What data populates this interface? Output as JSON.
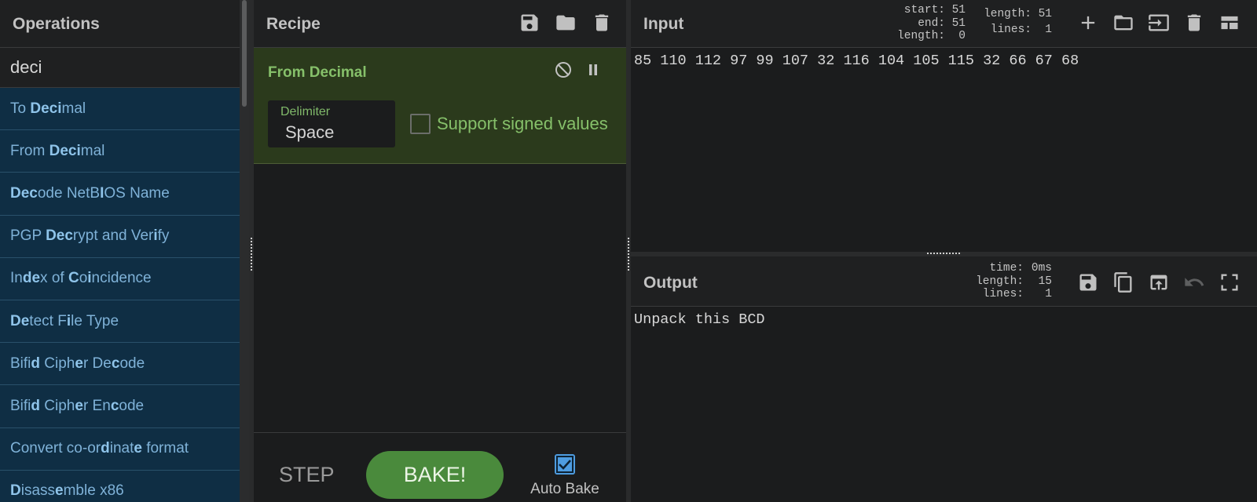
{
  "operations": {
    "title": "Operations",
    "search_value": "deci",
    "items": [
      [
        {
          "t": "To "
        },
        {
          "t": "Deci",
          "b": true
        },
        {
          "t": "mal"
        }
      ],
      [
        {
          "t": "From "
        },
        {
          "t": "Deci",
          "b": true
        },
        {
          "t": "mal"
        }
      ],
      [
        {
          "t": "Dec",
          "b": true
        },
        {
          "t": "ode NetB"
        },
        {
          "t": "I",
          "b": true
        },
        {
          "t": "OS Name"
        }
      ],
      [
        {
          "t": "PGP "
        },
        {
          "t": "Dec",
          "b": true
        },
        {
          "t": "rypt and Ver"
        },
        {
          "t": "i",
          "b": true
        },
        {
          "t": "fy"
        }
      ],
      [
        {
          "t": "In"
        },
        {
          "t": "de",
          "b": true
        },
        {
          "t": "x of "
        },
        {
          "t": "C",
          "b": true
        },
        {
          "t": "o"
        },
        {
          "t": "i",
          "b": true
        },
        {
          "t": "ncidence"
        }
      ],
      [
        {
          "t": "De",
          "b": true
        },
        {
          "t": "tec",
          "b": false
        },
        {
          "t": "t F"
        },
        {
          "t": "i",
          "b": true
        },
        {
          "t": "le Type"
        }
      ],
      [
        {
          "t": "Bifi"
        },
        {
          "t": "d",
          "b": true
        },
        {
          "t": " Ciph"
        },
        {
          "t": "e",
          "b": true
        },
        {
          "t": "r De"
        },
        {
          "t": "c",
          "b": true
        },
        {
          "t": "ode"
        }
      ],
      [
        {
          "t": "Bifi"
        },
        {
          "t": "d",
          "b": true
        },
        {
          "t": " Ciph"
        },
        {
          "t": "e",
          "b": true
        },
        {
          "t": "r En"
        },
        {
          "t": "c",
          "b": true
        },
        {
          "t": "ode"
        }
      ],
      [
        {
          "t": "Convert co-or"
        },
        {
          "t": "d",
          "b": true
        },
        {
          "t": "inat"
        },
        {
          "t": "e",
          "b": true
        },
        {
          "t": " format"
        }
      ],
      [
        {
          "t": "D",
          "b": true
        },
        {
          "t": "isass"
        },
        {
          "t": "e",
          "b": true
        },
        {
          "t": "mble x86"
        }
      ]
    ]
  },
  "recipe": {
    "title": "Recipe",
    "operation": {
      "name": "From Decimal",
      "delimiter_label": "Delimiter",
      "delimiter_value": "Space",
      "signed_label": "Support signed values",
      "signed_checked": false
    },
    "step_label": "STEP",
    "bake_label": "BAKE!",
    "autobake_label": "Auto Bake",
    "autobake_checked": true
  },
  "input": {
    "title": "Input",
    "sel_start_label": "start:",
    "sel_start": "51",
    "sel_end_label": "end:",
    "sel_end": "51",
    "sel_length_label": "length:",
    "sel_length": "0",
    "length_label": "length:",
    "length": "51",
    "lines_label": "lines:",
    "lines": "1",
    "text": "85 110 112 97 99 107 32 116 104 105 115 32 66 67 68"
  },
  "output": {
    "title": "Output",
    "time_label": "time:",
    "time": "0ms",
    "length_label": "length:",
    "length": "15",
    "lines_label": "lines:",
    "lines": "1",
    "text": "Unpack this BCD"
  },
  "colors": {
    "op_item_bg": "#0f2e44",
    "op_card_bg": "#2b3a1c",
    "accent_green": "#86c06a",
    "bake_button": "#4a8a3c",
    "checkbox_blue": "#4e9ce0"
  }
}
